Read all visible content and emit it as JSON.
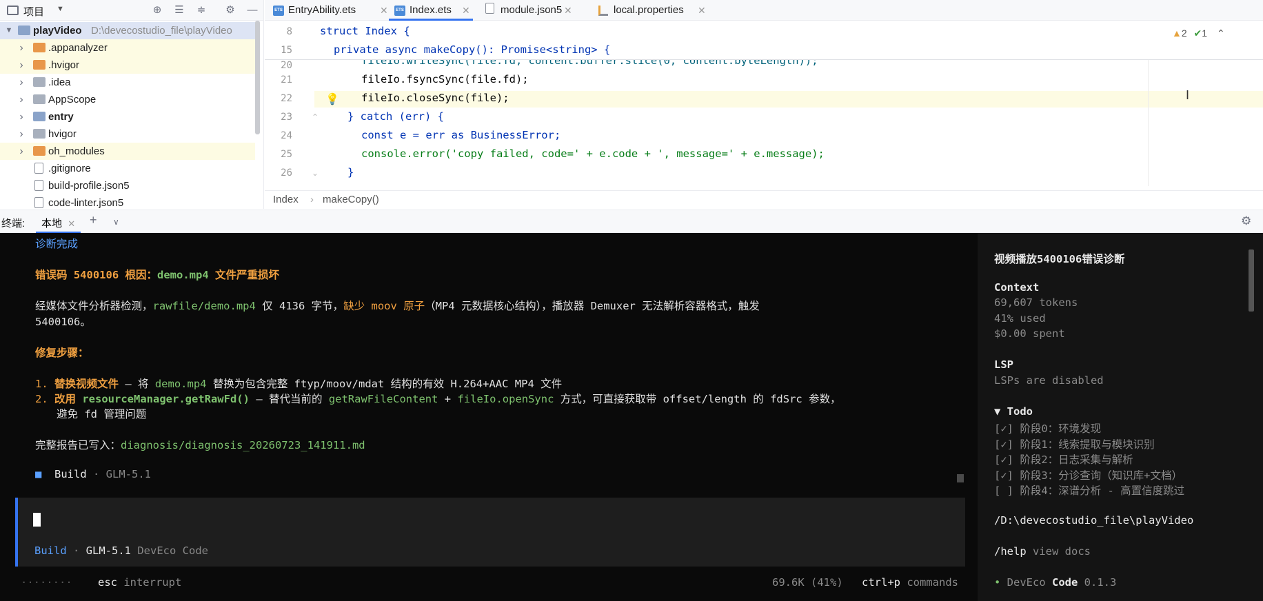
{
  "project_panel": {
    "title": "项目",
    "root": {
      "name": "playVideo",
      "path": "D:\\devecostudio_file\\playVideo"
    },
    "items": [
      {
        "label": ".appanalyzer",
        "type": "folder-orange",
        "expandable": true,
        "highlight": true
      },
      {
        "label": ".hvigor",
        "type": "folder-orange",
        "expandable": true,
        "highlight": true
      },
      {
        "label": ".idea",
        "type": "folder",
        "expandable": true,
        "highlight": false
      },
      {
        "label": "AppScope",
        "type": "folder",
        "expandable": true,
        "highlight": false
      },
      {
        "label": "entry",
        "type": "folder-blue",
        "expandable": true,
        "highlight": false,
        "bold": true
      },
      {
        "label": "hvigor",
        "type": "folder",
        "expandable": true,
        "highlight": false
      },
      {
        "label": "oh_modules",
        "type": "folder-orange",
        "expandable": true,
        "highlight": true
      },
      {
        "label": ".gitignore",
        "type": "file",
        "expandable": false,
        "highlight": false
      },
      {
        "label": "build-profile.json5",
        "type": "file",
        "expandable": false,
        "highlight": false
      },
      {
        "label": "code-linter.json5",
        "type": "file",
        "expandable": false,
        "highlight": false
      }
    ]
  },
  "editor_tabs": [
    {
      "label": "EntryAbility.ets",
      "active": false
    },
    {
      "label": "Index.ets",
      "active": true
    },
    {
      "label": "module.json5",
      "active": false
    },
    {
      "label": "local.properties",
      "active": false
    }
  ],
  "editor": {
    "sticky_lines": [
      {
        "num": "8",
        "text": "struct Index {"
      },
      {
        "num": "15",
        "text": "private async makeCopy(): Promise<string> {"
      }
    ],
    "lines": [
      {
        "num": "20",
        "text": "fileIo.writeSync(file.fd, content.buffer.slice(0, content.byteLength));"
      },
      {
        "num": "21",
        "text": "fileIo.fsyncSync(file.fd);"
      },
      {
        "num": "22",
        "text": "fileIo.closeSync(file);"
      },
      {
        "num": "23",
        "text": "} catch (err) {"
      },
      {
        "num": "24",
        "text": "const e = err as BusinessError;"
      },
      {
        "num": "25",
        "text": "console.error('copy failed, code=' + e.code + ', message=' + e.message);"
      },
      {
        "num": "26",
        "text": "}"
      }
    ],
    "inspections": {
      "warnings": "2",
      "weak": "1"
    },
    "breadcrumb": [
      "Index",
      "makeCopy()"
    ]
  },
  "terminal_bar": {
    "label": "终端:",
    "tab": "本地"
  },
  "terminal": {
    "lines": {
      "done": "诊断完成",
      "errcode_prefix": "错误码 5400106 根因：",
      "errcode_file": "demo.mp4",
      "errcode_suffix": " 文件严重损坏",
      "analysis_a": "经媒体文件分析器检测，",
      "analysis_path": "rawfile/demo.mp4",
      "analysis_b": " 仅 4136 字节，",
      "analysis_c": "缺少 moov 原子",
      "analysis_d": "（MP4 元数据核心结构），播放器 Demuxer 无法解析容器格式，触发",
      "analysis_e": "5400106。",
      "steps_title": "修复步骤：",
      "step1_num": "1. ",
      "step1_a": "替换视频文件",
      "step1_b": " — 将 ",
      "step1_c": "demo.mp4",
      "step1_d": " 替换为包含完整 ftyp/moov/mdat 结构的有效 H.264+AAC MP4 文件",
      "step2_num": "2. ",
      "step2_a": "改用 ",
      "step2_b": "resourceManager.getRawFd()",
      "step2_c": " — 替代当前的 ",
      "step2_d": "getRawFileContent",
      "step2_e": " + ",
      "step2_f": "fileIo.openSync",
      "step2_g": " 方式，可直接获取带 offset/length 的 fdSrc 参数，",
      "step2_h": "避免 fd 管理问题",
      "report_a": "完整报告已写入：",
      "report_b": "diagnosis/diagnosis_20260723_141911.md",
      "build_icon": "■",
      "build_a": "Build",
      "build_b": " · GLM-5.1"
    },
    "input": {
      "mode": "Build",
      "sep": " · ",
      "model": "GLM-5.1",
      "product": " DevEco Code"
    },
    "status": {
      "dots": "········",
      "esc_key": "esc",
      "esc_label": " interrupt",
      "usage": "69.6K (41%)",
      "cmd_key": "ctrl+p",
      "cmd_label": " commands"
    }
  },
  "sidebar": {
    "title": "视频播放5400106错误诊断",
    "context_title": "Context",
    "tokens": "69,607 tokens",
    "used": "41% used",
    "spent": "$0.00 spent",
    "lsp_title": "LSP",
    "lsp_status": "LSPs are disabled",
    "todo_title": "▼ Todo",
    "todos": [
      "[✓] 阶段0：环境发现",
      "[✓] 阶段1：线索提取与模块识别",
      "[✓] 阶段2：日志采集与解析",
      "[✓] 阶段3：分诊查询（知识库+文档）",
      "[ ] 阶段4：深谱分析 - 高置信度跳过"
    ],
    "cwd": "/D:\\devecostudio_file\\playVideo",
    "help_cmd": "/help",
    "help_label": " view docs",
    "brand_bullet": "• ",
    "brand_a": "DevEco",
    "brand_b": " Code",
    "version": " 0.1.3"
  }
}
